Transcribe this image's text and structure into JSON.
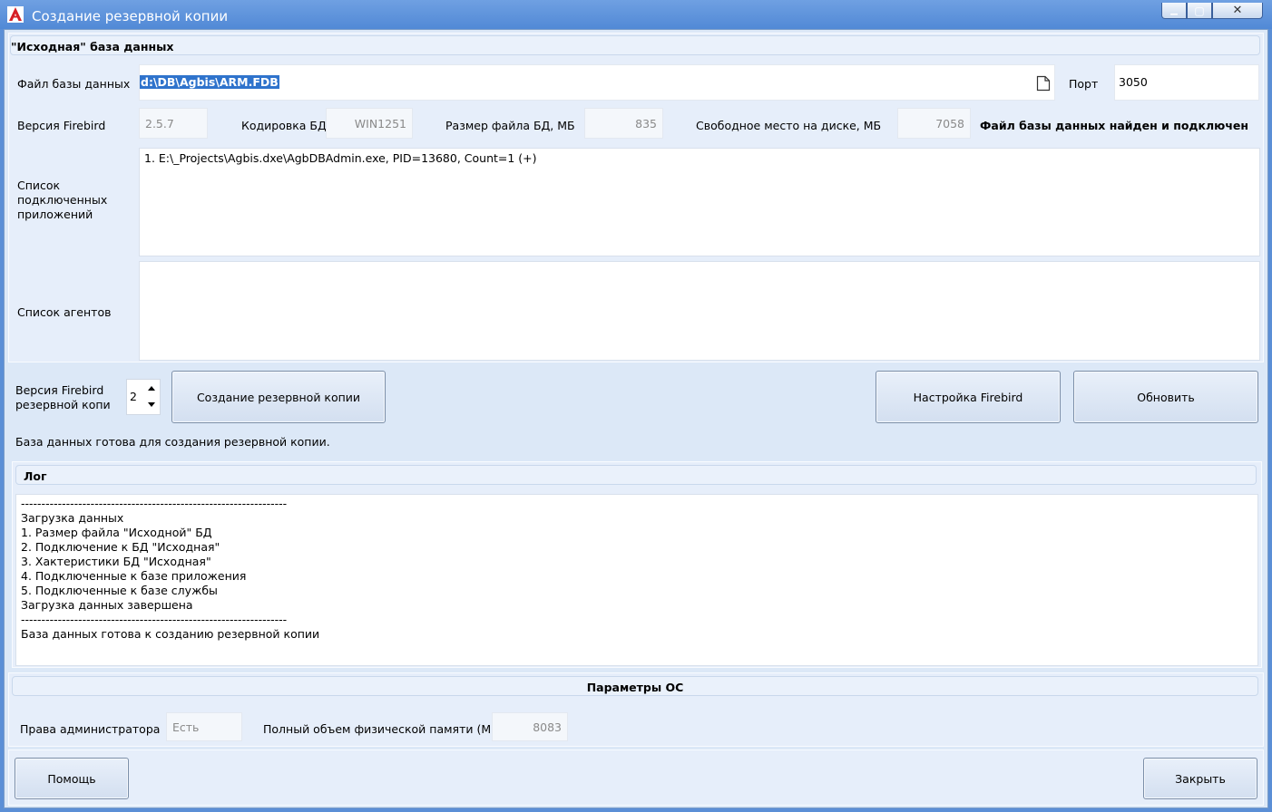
{
  "window": {
    "title": "Создание резервной копии",
    "btn_min": "▁",
    "btn_max": "▢",
    "btn_close": "✕"
  },
  "source": {
    "header": "\"Исходная\" база данных",
    "file_label": "Файл базы данных",
    "file_value": "d:\\DB\\Agbis\\ARM.FDB",
    "port_label": "Порт",
    "port_value": "3050",
    "fb_version_label": "Версия Firebird",
    "fb_version_value": "2.5.7",
    "encoding_label": "Кодировка БД",
    "encoding_value": "WIN1251",
    "filesize_label": "Размер файла  БД, МБ",
    "filesize_value": "835",
    "freespace_label": "Свободное место на диске, МБ",
    "freespace_value": "7058",
    "status_text": "Файл базы данных найден и подключен",
    "apps_label": "Список подключенных приложений",
    "apps_list": "1. E:\\_Projects\\Agbis.dxe\\AgbDBAdmin.exe, PID=13680, Count=1 (+)",
    "agents_label": "Список агентов",
    "agents_list": ""
  },
  "backup": {
    "version_label": "Версия Firebird резервной копи",
    "version_value": "2",
    "create_button": "Создание резервной копии",
    "settings_button": "Настройка Firebird",
    "refresh_button": "Обновить",
    "ready_text": "База данных готова для создания резервной копии."
  },
  "log": {
    "header": "Лог",
    "lines": "-----------------------------------------------------------------\nЗагрузка данных\n1. Размер файла \"Исходной\" БД\n2. Подключение к БД \"Исходная\"\n3. Хактеристики БД \"Исходная\"\n4. Подключенные к базе приложения\n5. Подключенные к базе службы\nЗагрузка данных завершена\n-----------------------------------------------------------------\nБаза данных готова к созданию резервной копии"
  },
  "os": {
    "header": "Параметры ОС",
    "admin_label": "Права администратора",
    "admin_value": "Есть",
    "memory_label": "Полный объем физической памяти (М)",
    "memory_value": "8083"
  },
  "footer": {
    "help_button": "Помощь",
    "close_button": "Закрыть"
  },
  "colors": {
    "titlebar": "#5b8fd6",
    "client": "#dce8f7",
    "selection": "#2f73cc"
  },
  "icons": {
    "app": "app-logo-icon",
    "file": "file-icon",
    "spin_up": "arrow-up-icon",
    "spin_down": "arrow-down-icon"
  }
}
